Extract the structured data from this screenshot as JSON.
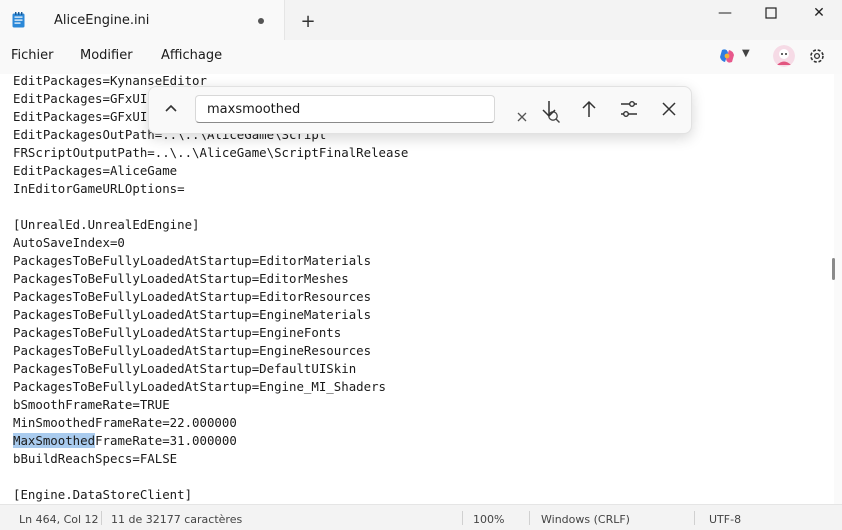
{
  "window": {
    "tab_title": "AliceEngine.ini",
    "new_tab": "+",
    "minimize": "—",
    "close": "✕"
  },
  "menu": {
    "file": "Fichier",
    "edit": "Modifier",
    "view": "Affichage"
  },
  "find": {
    "query": "maxsmoothed"
  },
  "editor": {
    "lines": [
      "EditPackages=KynanseEditor",
      "EditPackages=GFxUI",
      "EditPackages=GFxUIEditor",
      "EditPackagesOutPath=..\\..\\AliceGame\\Script",
      "FRScriptOutputPath=..\\..\\AliceGame\\ScriptFinalRelease",
      "EditPackages=AliceGame",
      "InEditorGameURLOptions=",
      "",
      "[UnrealEd.UnrealEdEngine]",
      "AutoSaveIndex=0",
      "PackagesToBeFullyLoadedAtStartup=EditorMaterials",
      "PackagesToBeFullyLoadedAtStartup=EditorMeshes",
      "PackagesToBeFullyLoadedAtStartup=EditorResources",
      "PackagesToBeFullyLoadedAtStartup=EngineMaterials",
      "PackagesToBeFullyLoadedAtStartup=EngineFonts",
      "PackagesToBeFullyLoadedAtStartup=EngineResources",
      "PackagesToBeFullyLoadedAtStartup=DefaultUISkin",
      "PackagesToBeFullyLoadedAtStartup=Engine_MI_Shaders",
      "bSmoothFrameRate=TRUE",
      "MinSmoothedFrameRate=22.000000",
      "bBuildReachSpecs=FALSE",
      "",
      "[Engine.DataStoreClient]"
    ],
    "match_line": {
      "highlight": "MaxSmoothed",
      "rest": "FrameRate=31.000000"
    }
  },
  "status": {
    "position": "Ln 464, Col 12",
    "selection": "11 de 32177 caractères",
    "zoom": "100%",
    "line_endings": "Windows (CRLF)",
    "encoding": "UTF-8"
  },
  "colors": {
    "selection_highlight": "#a9cbee",
    "app_icon": "#2b88d8"
  }
}
